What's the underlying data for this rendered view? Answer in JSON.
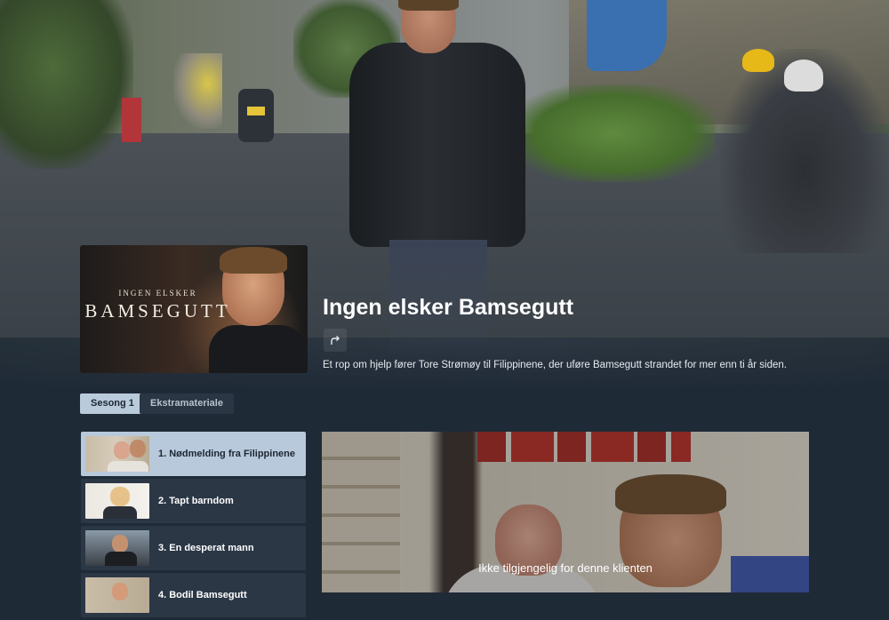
{
  "show": {
    "poster_kicker": "INGEN ELSKER",
    "poster_title": "BAMSEGUTT",
    "title": "Ingen elsker Bamsegutt",
    "share_icon": "share-arrow-icon",
    "description": "Et rop om hjelp fører Tore Strømøy til Filippinene, der uføre Bamsegutt strandet for mer enn ti år siden."
  },
  "tabs": [
    {
      "label": "Sesong 1",
      "active": true
    },
    {
      "label": "Ekstramateriale",
      "active": false
    }
  ],
  "episodes": [
    {
      "title": "1. Nødmelding fra Filippinene",
      "active": true
    },
    {
      "title": "2. Tapt barndom",
      "active": false
    },
    {
      "title": "3. En desperat mann",
      "active": false
    },
    {
      "title": "4. Bodil Bamsegutt",
      "active": false
    }
  ],
  "player": {
    "message": "Ikke tilgjengelig for denne klienten"
  },
  "colors": {
    "background": "#1f2a37",
    "active_accent": "#b8c9db"
  }
}
